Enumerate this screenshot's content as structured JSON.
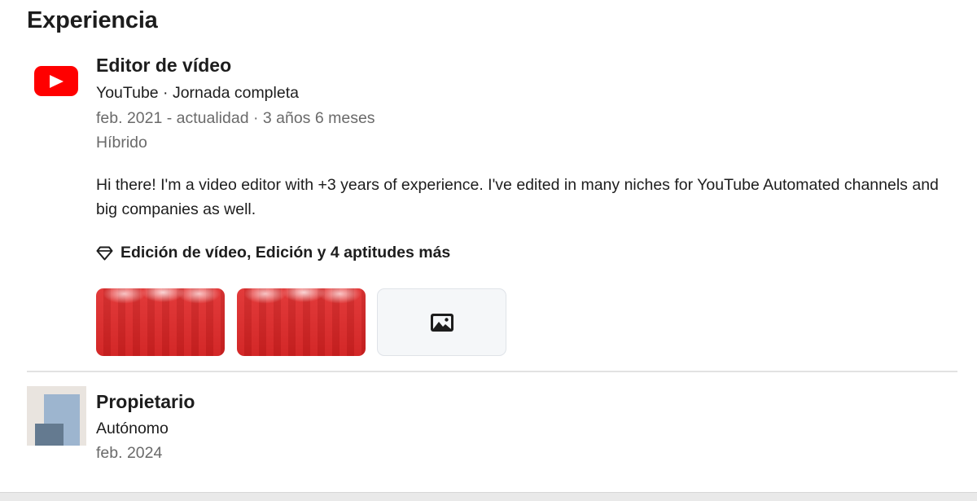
{
  "section": {
    "title": "Experiencia"
  },
  "experiences": [
    {
      "logo": "youtube-logo-icon",
      "title": "Editor de vídeo",
      "company_line": "YouTube · Jornada completa",
      "dates": "feb. 2021 - actualidad · 3 años 6 meses",
      "location": "Híbrido",
      "description": "Hi there! I'm a video editor with +3 years of experience. I've edited in many niches for YouTube Automated channels and big companies as well.",
      "skills_icon": "diamond-icon",
      "skills": "Edición de vídeo, Edición y 4 aptitudes más",
      "media": [
        "red-thumbnail",
        "red-thumbnail",
        "image-placeholder-icon"
      ]
    },
    {
      "logo": "generic-company-logo",
      "title": "Propietario",
      "company_line": "Autónomo",
      "dates": "feb. 2024"
    }
  ],
  "colors": {
    "youtube_red": "#ff0000",
    "secondary_text": "#6a6a6a",
    "divider": "#e2e2e2"
  }
}
